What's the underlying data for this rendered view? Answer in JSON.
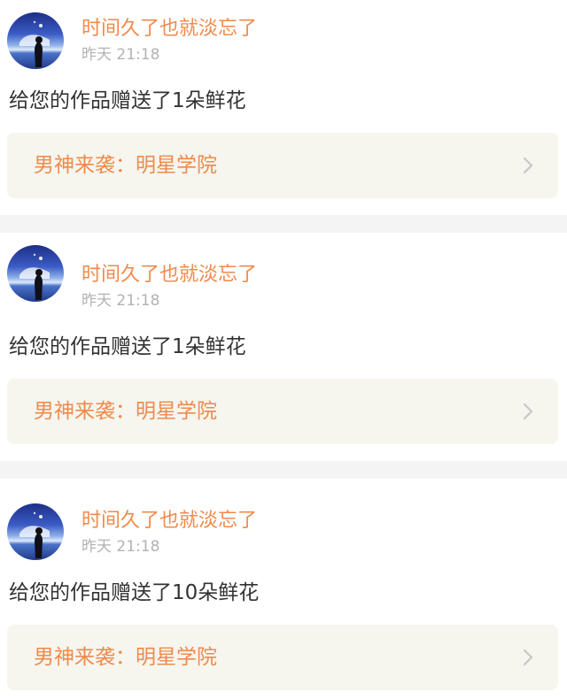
{
  "notifications": [
    {
      "username": "时间久了也就淡忘了",
      "time": "昨天 21:18",
      "message": "给您的作品赠送了1朵鲜花",
      "work_title": "男神来袭：明星学院",
      "avatar_icon": "avatar-image",
      "arrow_icon": "chevron-right-icon"
    },
    {
      "username": "时间久了也就淡忘了",
      "time": "昨天 21:18",
      "message": "给您的作品赠送了1朵鲜花",
      "work_title": "男神来袭：明星学院",
      "avatar_icon": "avatar-image",
      "arrow_icon": "chevron-right-icon"
    },
    {
      "username": "时间久了也就淡忘了",
      "time": "昨天 21:18",
      "message": "给您的作品赠送了10朵鲜花",
      "work_title": "男神来袭：明星学院",
      "avatar_icon": "avatar-image",
      "arrow_icon": "chevron-right-icon"
    }
  ],
  "colors": {
    "accent": "#f08a4b",
    "text": "#333333",
    "muted": "#b2b2b2",
    "card_link_bg": "#f6f5ee",
    "divider": "#f4f4f4"
  }
}
